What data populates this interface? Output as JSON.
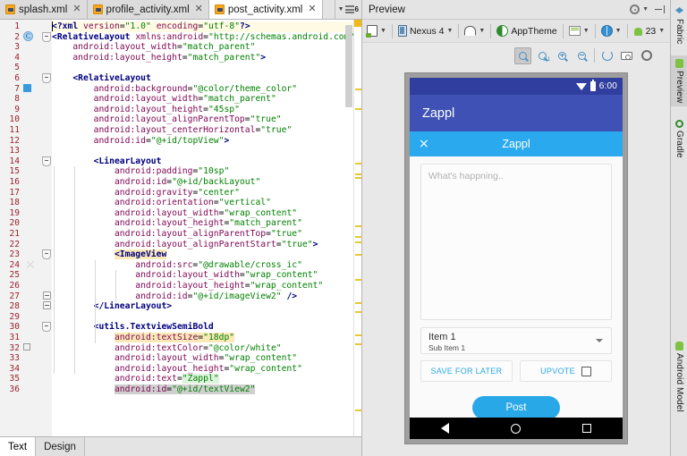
{
  "editor": {
    "tabs": [
      {
        "label": "splash.xml",
        "active": false,
        "icon": "xml-file-icon"
      },
      {
        "label": "profile_activity.xml",
        "active": false,
        "icon": "xml-file-icon"
      },
      {
        "label": "post_activity.xml",
        "active": true,
        "icon": "xml-file-icon"
      }
    ],
    "tab_overflow_count": "6",
    "bottom_tabs": [
      {
        "label": "Text",
        "active": true
      },
      {
        "label": "Design",
        "active": false
      }
    ],
    "code_lines": [
      {
        "n": 1,
        "indent": 0,
        "highlighted": true,
        "tokens": [
          {
            "t": "pi",
            "s": "<?xml "
          },
          {
            "t": "attr",
            "s": "version"
          },
          {
            "t": "eq",
            "s": "="
          },
          {
            "t": "val",
            "s": "\"1.0\""
          },
          {
            "t": "plain",
            "s": " "
          },
          {
            "t": "attr",
            "s": "encoding"
          },
          {
            "t": "eq",
            "s": "="
          },
          {
            "t": "val",
            "s": "\"utf-8\""
          },
          {
            "t": "pi",
            "s": "?>"
          }
        ]
      },
      {
        "n": 2,
        "indent": 0,
        "tokens": [
          {
            "t": "tag",
            "s": "<RelativeLayout "
          },
          {
            "t": "ns",
            "s": "xmlns:android"
          },
          {
            "t": "eq",
            "s": "="
          },
          {
            "t": "val",
            "s": "\"http://schemas.android.com/apk"
          }
        ]
      },
      {
        "n": 3,
        "indent": 1,
        "tokens": [
          {
            "t": "attr",
            "s": "android:layout_width"
          },
          {
            "t": "eq",
            "s": "="
          },
          {
            "t": "val",
            "s": "\"match_parent\""
          }
        ]
      },
      {
        "n": 4,
        "indent": 1,
        "tokens": [
          {
            "t": "attr",
            "s": "android:layout_height"
          },
          {
            "t": "eq",
            "s": "="
          },
          {
            "t": "val",
            "s": "\"match_parent\""
          },
          {
            "t": "tag",
            "s": ">"
          }
        ]
      },
      {
        "n": 5,
        "indent": 0,
        "tokens": []
      },
      {
        "n": 6,
        "indent": 1,
        "tokens": [
          {
            "t": "tag",
            "s": "<RelativeLayout"
          }
        ]
      },
      {
        "n": 7,
        "indent": 2,
        "tokens": [
          {
            "t": "attr",
            "s": "android:background"
          },
          {
            "t": "eq",
            "s": "="
          },
          {
            "t": "val",
            "s": "\"@color/theme_color\""
          }
        ]
      },
      {
        "n": 8,
        "indent": 2,
        "tokens": [
          {
            "t": "attr",
            "s": "android:layout_width"
          },
          {
            "t": "eq",
            "s": "="
          },
          {
            "t": "val",
            "s": "\"match_parent\""
          }
        ]
      },
      {
        "n": 9,
        "indent": 2,
        "tokens": [
          {
            "t": "attr",
            "s": "android:layout_height"
          },
          {
            "t": "eq",
            "s": "="
          },
          {
            "t": "val",
            "s": "\"45sp\""
          }
        ]
      },
      {
        "n": 10,
        "indent": 2,
        "tokens": [
          {
            "t": "attr",
            "s": "android:layout_alignParentTop"
          },
          {
            "t": "eq",
            "s": "="
          },
          {
            "t": "val",
            "s": "\"true\""
          }
        ]
      },
      {
        "n": 11,
        "indent": 2,
        "tokens": [
          {
            "t": "attr",
            "s": "android:layout_centerHorizontal"
          },
          {
            "t": "eq",
            "s": "="
          },
          {
            "t": "val",
            "s": "\"true\""
          }
        ]
      },
      {
        "n": 12,
        "indent": 2,
        "tokens": [
          {
            "t": "attr",
            "s": "android:id"
          },
          {
            "t": "eq",
            "s": "="
          },
          {
            "t": "val",
            "s": "\"@+id/topView\""
          },
          {
            "t": "tag",
            "s": ">"
          }
        ]
      },
      {
        "n": 13,
        "indent": 0,
        "tokens": []
      },
      {
        "n": 14,
        "indent": 2,
        "tokens": [
          {
            "t": "tag",
            "s": "<LinearLayout"
          }
        ]
      },
      {
        "n": 15,
        "indent": 3,
        "tokens": [
          {
            "t": "attr",
            "s": "android:padding"
          },
          {
            "t": "eq",
            "s": "="
          },
          {
            "t": "val",
            "s": "\"10sp\""
          }
        ]
      },
      {
        "n": 16,
        "indent": 3,
        "tokens": [
          {
            "t": "attr",
            "s": "android:id"
          },
          {
            "t": "eq",
            "s": "="
          },
          {
            "t": "val",
            "s": "\"@+id/backLayout\""
          }
        ]
      },
      {
        "n": 17,
        "indent": 3,
        "tokens": [
          {
            "t": "attr",
            "s": "android:gravity"
          },
          {
            "t": "eq",
            "s": "="
          },
          {
            "t": "val",
            "s": "\"center\""
          }
        ]
      },
      {
        "n": 18,
        "indent": 3,
        "tokens": [
          {
            "t": "attr",
            "s": "android:orientation"
          },
          {
            "t": "eq",
            "s": "="
          },
          {
            "t": "val",
            "s": "\"vertical\""
          }
        ]
      },
      {
        "n": 19,
        "indent": 3,
        "tokens": [
          {
            "t": "attr",
            "s": "android:layout_width"
          },
          {
            "t": "eq",
            "s": "="
          },
          {
            "t": "val",
            "s": "\"wrap_content\""
          }
        ]
      },
      {
        "n": 20,
        "indent": 3,
        "tokens": [
          {
            "t": "attr",
            "s": "android:layout_height"
          },
          {
            "t": "eq",
            "s": "="
          },
          {
            "t": "val",
            "s": "\"match_parent\""
          }
        ]
      },
      {
        "n": 21,
        "indent": 3,
        "tokens": [
          {
            "t": "attr",
            "s": "android:layout_alignParentTop"
          },
          {
            "t": "eq",
            "s": "="
          },
          {
            "t": "val",
            "s": "\"true\""
          }
        ]
      },
      {
        "n": 22,
        "indent": 3,
        "tokens": [
          {
            "t": "attr",
            "s": "android:layout_alignParentStart"
          },
          {
            "t": "eq",
            "s": "="
          },
          {
            "t": "val",
            "s": "\"true\""
          },
          {
            "t": "tag",
            "s": ">"
          }
        ]
      },
      {
        "n": 23,
        "indent": 3,
        "tokens": [
          {
            "t": "tagsel",
            "s": "<ImageView"
          }
        ]
      },
      {
        "n": 24,
        "indent": 4,
        "tokens": [
          {
            "t": "attr",
            "s": "android:src"
          },
          {
            "t": "eq",
            "s": "="
          },
          {
            "t": "val",
            "s": "\"@drawable/cross_ic\""
          }
        ]
      },
      {
        "n": 25,
        "indent": 4,
        "tokens": [
          {
            "t": "attr",
            "s": "android:layout_width"
          },
          {
            "t": "eq",
            "s": "="
          },
          {
            "t": "val",
            "s": "\"wrap_content\""
          }
        ]
      },
      {
        "n": 26,
        "indent": 4,
        "tokens": [
          {
            "t": "attr",
            "s": "android:layout_height"
          },
          {
            "t": "eq",
            "s": "="
          },
          {
            "t": "val",
            "s": "\"wrap_content\""
          }
        ]
      },
      {
        "n": 27,
        "indent": 4,
        "tokens": [
          {
            "t": "attr",
            "s": "android:id"
          },
          {
            "t": "eq",
            "s": "="
          },
          {
            "t": "val",
            "s": "\"@+id/imageView2\""
          },
          {
            "t": "plain",
            "s": " "
          },
          {
            "t": "tag",
            "s": "/>"
          }
        ]
      },
      {
        "n": 28,
        "indent": 2,
        "tokens": [
          {
            "t": "tag",
            "s": "</LinearLayout>"
          }
        ]
      },
      {
        "n": 29,
        "indent": 0,
        "tokens": []
      },
      {
        "n": 30,
        "indent": 2,
        "tokens": [
          {
            "t": "tag",
            "s": "<utils.TextviewSemiBold"
          }
        ]
      },
      {
        "n": 31,
        "indent": 3,
        "tokens": [
          {
            "t": "attrhl",
            "s": "android:textSize"
          },
          {
            "t": "eqhl",
            "s": "="
          },
          {
            "t": "valhl",
            "s": "\"18dp\""
          }
        ]
      },
      {
        "n": 32,
        "indent": 3,
        "tokens": [
          {
            "t": "attr",
            "s": "android:textColor"
          },
          {
            "t": "eq",
            "s": "="
          },
          {
            "t": "val",
            "s": "\"@color/white\""
          }
        ]
      },
      {
        "n": 33,
        "indent": 3,
        "tokens": [
          {
            "t": "attr",
            "s": "android:layout_width"
          },
          {
            "t": "eq",
            "s": "="
          },
          {
            "t": "val",
            "s": "\"wrap_content\""
          }
        ]
      },
      {
        "n": 34,
        "indent": 3,
        "tokens": [
          {
            "t": "attr",
            "s": "android:layout_height"
          },
          {
            "t": "eq",
            "s": "="
          },
          {
            "t": "val",
            "s": "\"wrap_content\""
          }
        ]
      },
      {
        "n": 35,
        "indent": 3,
        "tokens": [
          {
            "t": "attr",
            "s": "android:text"
          },
          {
            "t": "eq",
            "s": "="
          },
          {
            "t": "valsel",
            "s": "\"Zappl\""
          }
        ]
      },
      {
        "n": 36,
        "indent": 3,
        "tokens": [
          {
            "t": "attrsel",
            "s": "android:id"
          },
          {
            "t": "eqsel",
            "s": "="
          },
          {
            "t": "valsel2",
            "s": "\"@+id/textView2\""
          }
        ]
      }
    ]
  },
  "preview": {
    "title": "Preview",
    "toolbar": {
      "device_menu": "",
      "device_name": "Nexus 4",
      "orientation": "",
      "theme": "AppTheme",
      "locale": "",
      "language": "",
      "api_level": "23"
    },
    "zoom_buttons": [
      "zoom-to-fit",
      "zoom-actual-size",
      "zoom-in",
      "zoom-out",
      "refresh",
      "screenshot",
      "settings"
    ],
    "device": {
      "status_bar": {
        "time": "6:00",
        "wifi": "wifi-icon",
        "battery": "battery-icon"
      },
      "app_bar_title": "Zappl",
      "toolbar": {
        "close": "×",
        "title": "Zappl"
      },
      "post_input_placeholder": "What's happning..",
      "spinner": {
        "main": "Item 1",
        "sub": "Sub Item 1"
      },
      "buttons": {
        "save_for_later": "SAVE FOR LATER",
        "upvote": "UPVOTE",
        "post": "Post"
      },
      "nav_bar": [
        "back",
        "home",
        "recents"
      ],
      "colors": {
        "status_bar": "#303f9f",
        "app_bar": "#3f51b5",
        "secondary_toolbar": "#2aa9ef",
        "accent": "#29a8e8",
        "screen_bg": "#fafafa"
      }
    }
  },
  "tool_strip": {
    "tabs": [
      {
        "label": "Fabric",
        "icon": "fabric-icon",
        "active": false
      },
      {
        "label": "Preview",
        "icon": "preview-icon",
        "active": true
      },
      {
        "label": "Gradle",
        "icon": "gradle-icon",
        "active": false
      },
      {
        "label": "Android Model",
        "icon": "android-model-icon",
        "active": false
      }
    ]
  }
}
